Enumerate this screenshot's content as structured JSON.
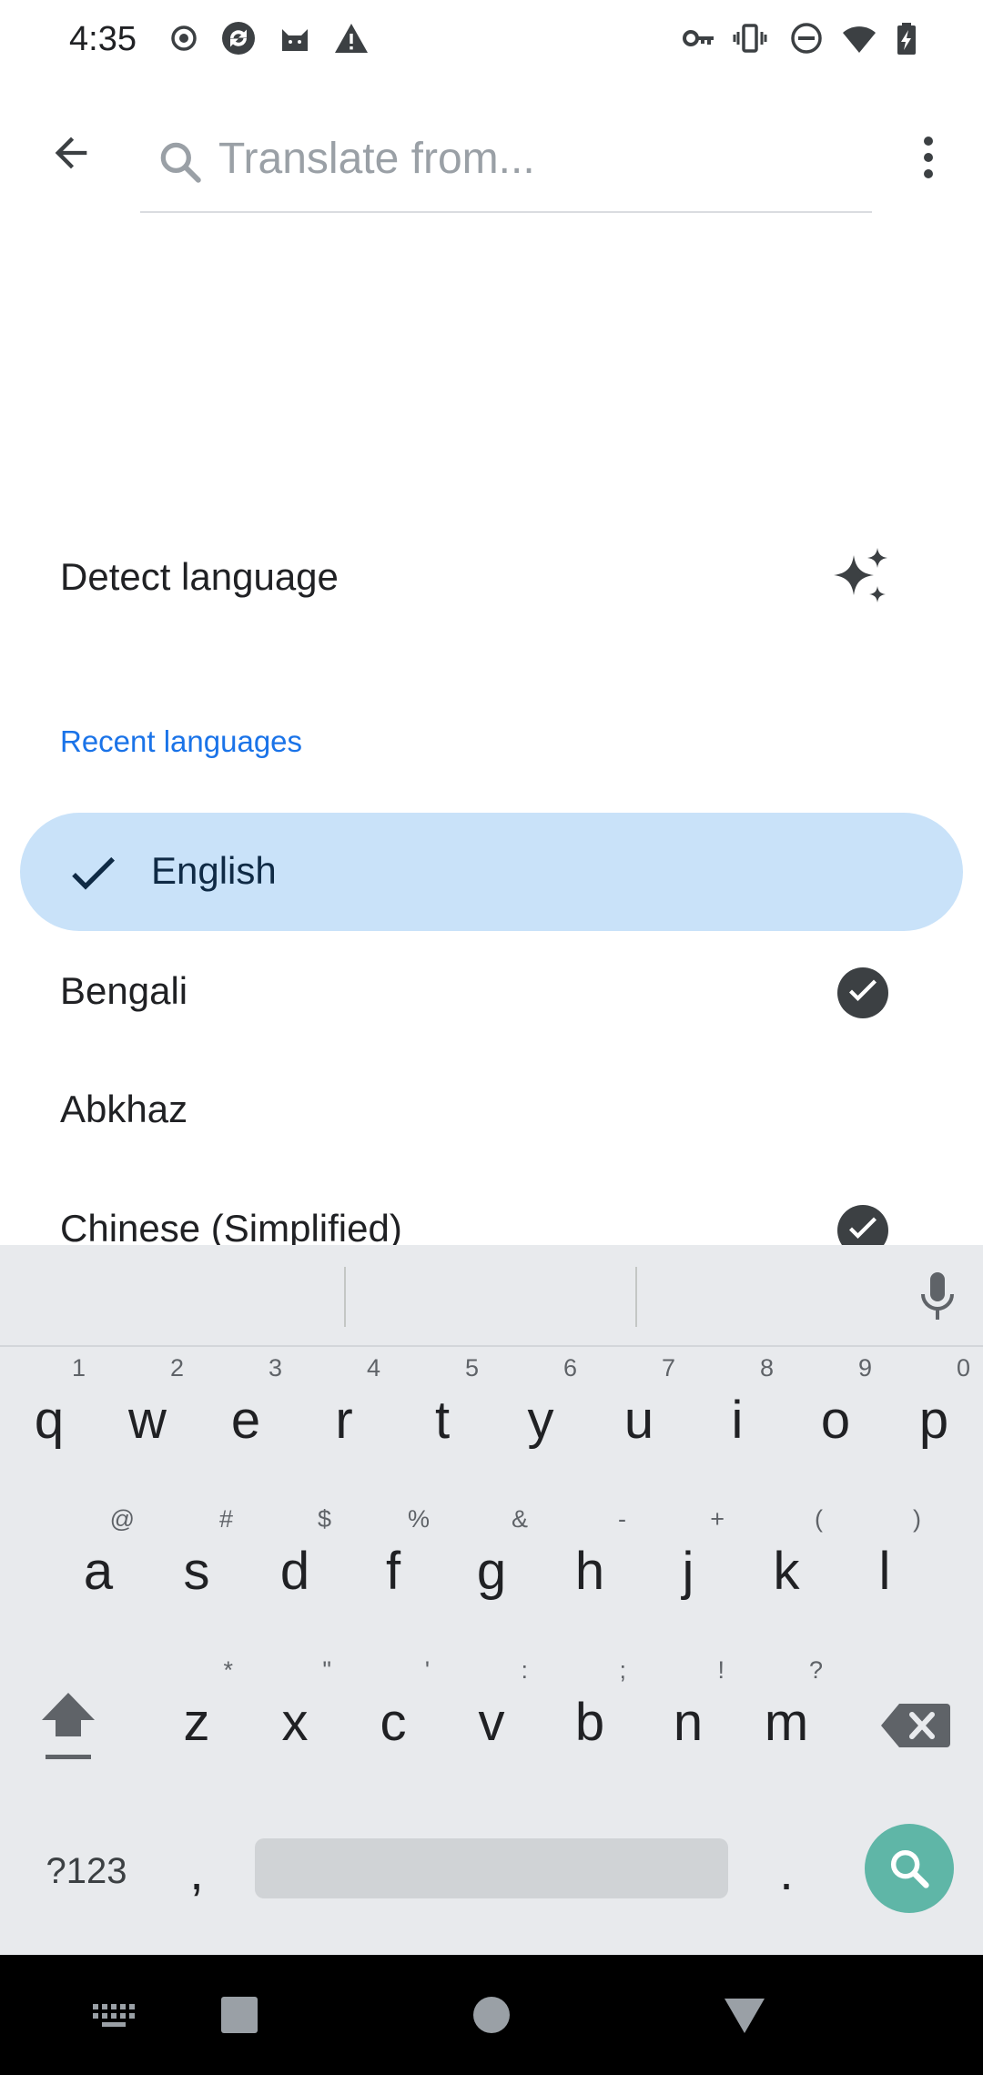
{
  "status_bar": {
    "time": "4:35",
    "left_icons": [
      "record-icon",
      "sync-app-icon",
      "cat-app-icon",
      "alert-icon"
    ],
    "right_icons": [
      "vpn-key-icon",
      "vibrate-icon",
      "do-not-disturb-icon",
      "wifi-icon",
      "battery-charging-icon"
    ]
  },
  "app_bar": {
    "search_placeholder": "Translate from...",
    "search_value": ""
  },
  "detect_language": {
    "label": "Detect language",
    "icon": "sparkle-icon"
  },
  "recent_section": {
    "title": "Recent languages",
    "accent_color": "#1a73e8"
  },
  "languages": [
    {
      "label": "English",
      "selected": true,
      "downloaded": false
    },
    {
      "label": "Bengali",
      "selected": false,
      "downloaded": true
    },
    {
      "label": "Abkhaz",
      "selected": false,
      "downloaded": false
    },
    {
      "label": "Chinese (Simplified)",
      "selected": false,
      "downloaded": true
    }
  ],
  "keyboard": {
    "row1": [
      {
        "key": "q",
        "hint": "1"
      },
      {
        "key": "w",
        "hint": "2"
      },
      {
        "key": "e",
        "hint": "3"
      },
      {
        "key": "r",
        "hint": "4"
      },
      {
        "key": "t",
        "hint": "5"
      },
      {
        "key": "y",
        "hint": "6"
      },
      {
        "key": "u",
        "hint": "7"
      },
      {
        "key": "i",
        "hint": "8"
      },
      {
        "key": "o",
        "hint": "9"
      },
      {
        "key": "p",
        "hint": "0"
      }
    ],
    "row2": [
      {
        "key": "a",
        "hint": "@"
      },
      {
        "key": "s",
        "hint": "#"
      },
      {
        "key": "d",
        "hint": "$"
      },
      {
        "key": "f",
        "hint": "%"
      },
      {
        "key": "g",
        "hint": "&"
      },
      {
        "key": "h",
        "hint": "-"
      },
      {
        "key": "j",
        "hint": "+"
      },
      {
        "key": "k",
        "hint": "("
      },
      {
        "key": "l",
        "hint": ")"
      }
    ],
    "row3": [
      {
        "key": "z",
        "hint": "*"
      },
      {
        "key": "x",
        "hint": "\""
      },
      {
        "key": "c",
        "hint": "'"
      },
      {
        "key": "v",
        "hint": ":"
      },
      {
        "key": "b",
        "hint": ";"
      },
      {
        "key": "n",
        "hint": "!"
      },
      {
        "key": "m",
        "hint": "?"
      }
    ],
    "symbols_label": "?123",
    "comma": ",",
    "period": ".",
    "action_color": "#5fb6a7"
  },
  "nav_bar": {
    "buttons": [
      "keyboard-switch-icon",
      "recents-icon",
      "home-icon",
      "back-nav-icon"
    ]
  }
}
